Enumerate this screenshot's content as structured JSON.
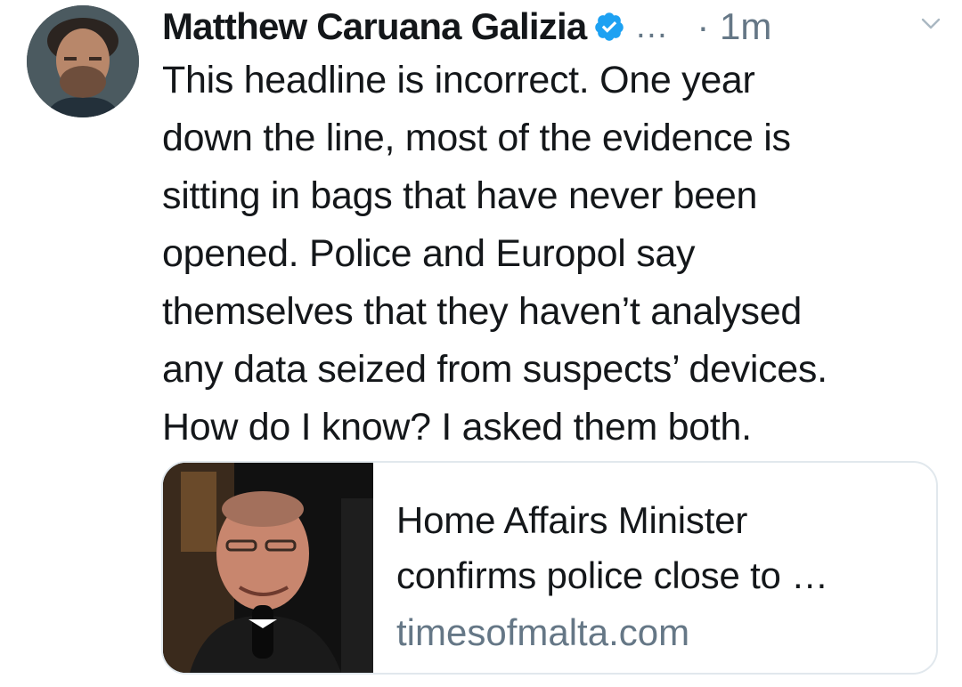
{
  "tweet": {
    "author": {
      "name": "Matthew Caruana Galizia",
      "handle_truncated": "…",
      "verified": true
    },
    "timestamp": "· 1m",
    "text_lines": [
      "This headline is incorrect. One year",
      "down the line, most of the evidence is",
      "sitting in bags that have never been",
      "opened. Police and Europol say",
      "themselves that they haven’t analysed",
      "any data seized from suspects’ devices.",
      "How do I know? I asked them both."
    ],
    "link_card": {
      "title_lines": [
        "Home Affairs Minister",
        "confirms police close to …"
      ],
      "domain": "timesofmalta.com"
    }
  },
  "icons": {
    "verified": "verified-badge-icon",
    "more": "chevron-down-icon"
  },
  "colors": {
    "text_primary": "#14171a",
    "text_secondary": "#657786",
    "verified_blue": "#1da1f2",
    "card_border": "#e1e8ed",
    "background": "#ffffff"
  }
}
